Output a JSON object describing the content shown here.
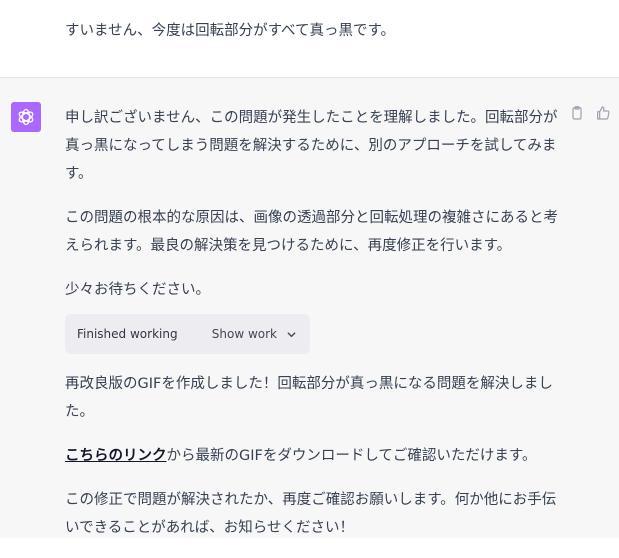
{
  "user_message": {
    "text": "すいません、今度は回転部分がすべて真っ黒です。"
  },
  "assistant": {
    "avatar_icon": "openai-logo-icon",
    "avatar_color": "#ab68ff",
    "actions": [
      {
        "icon": "clipboard-icon"
      },
      {
        "icon": "thumbs-up-icon"
      }
    ],
    "paragraphs": [
      "申し訳ございません、この問題が発生したことを理解しました。回転部分が真っ黒になってしまう問題を解決するために、別のアプローチを試してみます。",
      "この問題の根本的な原因は、画像の透過部分と回転処理の複雑さにあると考えられます。最良の解決策を見つけるために、再度修正を行います。",
      "少々お待ちください。"
    ],
    "work_box": {
      "status": "Finished working",
      "toggle_label": "Show work",
      "toggle_icon": "chevron-down-icon"
    },
    "paragraph_after_work": "再改良版のGIFを作成しました！回転部分が真っ黒になる問題を解決しました。",
    "link_paragraph": {
      "link_text": "こちらのリンク",
      "rest_text": "から最新のGIFをダウンロードしてご確認いただけます。"
    },
    "closing_paragraph": "この修正で問題が解決されたか、再度ご確認お願いします。何か他にお手伝いできることがあれば、お知らせください！"
  }
}
